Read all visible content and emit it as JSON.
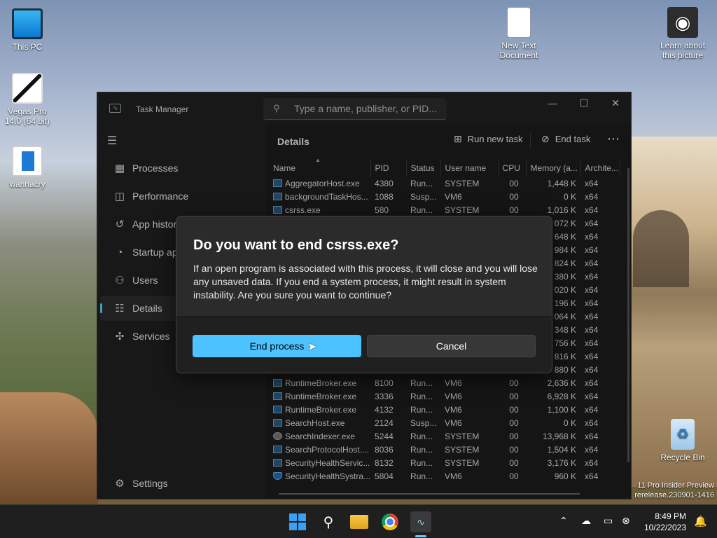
{
  "desktop": {
    "icons": {
      "this_pc": "This PC",
      "vegas": "Vegas Pro 14.0 (64 bit)",
      "wannacry": "wannacry",
      "new_text": "New Text Document",
      "learn": "Learn about this picture",
      "recycle": "Recycle Bin"
    },
    "watermark": {
      "line1": "11 Pro Insider Preview",
      "line2": "rerelease.230901-1416"
    }
  },
  "task_manager": {
    "title": "Task Manager",
    "search_placeholder": "Type a name, publisher, or PID...",
    "window_buttons": {
      "minimize": "—",
      "maximize": "☐",
      "close": "✕"
    },
    "nav": {
      "processes": "Processes",
      "performance": "Performance",
      "app_history": "App history",
      "startup": "Startup apps",
      "users": "Users",
      "details": "Details",
      "services": "Services",
      "settings": "Settings"
    },
    "header": {
      "title": "Details",
      "run_new_task": "Run new task",
      "end_task": "End task",
      "more": "⋯"
    },
    "columns": [
      "Name",
      "PID",
      "Status",
      "User name",
      "CPU",
      "Memory (a...",
      "Archite..."
    ],
    "rows": [
      [
        "AggregatorHost.exe",
        "4380",
        "Run...",
        "SYSTEM",
        "00",
        "1,448 K",
        "x64"
      ],
      [
        "backgroundTaskHos...",
        "1088",
        "Susp...",
        "VM6",
        "00",
        "0 K",
        "x64"
      ],
      [
        "csrss.exe",
        "580",
        "Run...",
        "SYSTEM",
        "00",
        "1,016 K",
        "x64"
      ],
      [
        "",
        "",
        "",
        "",
        "",
        "072 K",
        "x64"
      ],
      [
        "",
        "",
        "",
        "",
        "",
        "648 K",
        "x64"
      ],
      [
        "",
        "",
        "",
        "",
        "",
        "984 K",
        "x64"
      ],
      [
        "",
        "",
        "",
        "",
        "",
        "824 K",
        "x64"
      ],
      [
        "",
        "",
        "",
        "",
        "",
        "380 K",
        "x64"
      ],
      [
        "",
        "",
        "",
        "",
        "",
        "020 K",
        "x64"
      ],
      [
        "",
        "",
        "",
        "",
        "",
        "196 K",
        "x64"
      ],
      [
        "",
        "",
        "",
        "",
        "",
        "064 K",
        "x64"
      ],
      [
        "",
        "",
        "",
        "",
        "",
        "348 K",
        "x64"
      ],
      [
        "",
        "",
        "",
        "",
        "",
        "756 K",
        "x64"
      ],
      [
        "",
        "",
        "",
        "",
        "",
        "816 K",
        "x64"
      ],
      [
        "",
        "",
        "",
        "",
        "",
        "880 K",
        "x64"
      ],
      [
        "RuntimeBroker.exe",
        "8100",
        "Run...",
        "VM6",
        "00",
        "2,636 K",
        "x64"
      ],
      [
        "RuntimeBroker.exe",
        "3336",
        "Run...",
        "VM6",
        "00",
        "6,928 K",
        "x64"
      ],
      [
        "RuntimeBroker.exe",
        "4132",
        "Run...",
        "VM6",
        "00",
        "1,100 K",
        "x64"
      ],
      [
        "SearchHost.exe",
        "2124",
        "Susp...",
        "VM6",
        "00",
        "0 K",
        "x64"
      ],
      [
        "SearchIndexer.exe",
        "5244",
        "Run...",
        "SYSTEM",
        "00",
        "13,968 K",
        "x64"
      ],
      [
        "SearchProtocolHost....",
        "8036",
        "Run...",
        "SYSTEM",
        "00",
        "1,504 K",
        "x64"
      ],
      [
        "SecurityHealthServic...",
        "8132",
        "Run...",
        "SYSTEM",
        "00",
        "3,176 K",
        "x64"
      ],
      [
        "SecurityHealthSystra...",
        "5804",
        "Run...",
        "VM6",
        "00",
        "960 K",
        "x64"
      ]
    ]
  },
  "dialog": {
    "title": "Do you want to end csrss.exe?",
    "body": "If an open program is associated with this process, it will close and you will lose any unsaved data. If you end a system process, it might result in system instability. Are you sure you want to continue?",
    "primary": "End process",
    "secondary": "Cancel"
  },
  "taskbar": {
    "time": "8:49 PM",
    "date": "10/22/2023"
  },
  "colors": {
    "accent": "#4cc2ff",
    "window_bg": "#202020",
    "dialog_bg": "#2b2b2b"
  }
}
